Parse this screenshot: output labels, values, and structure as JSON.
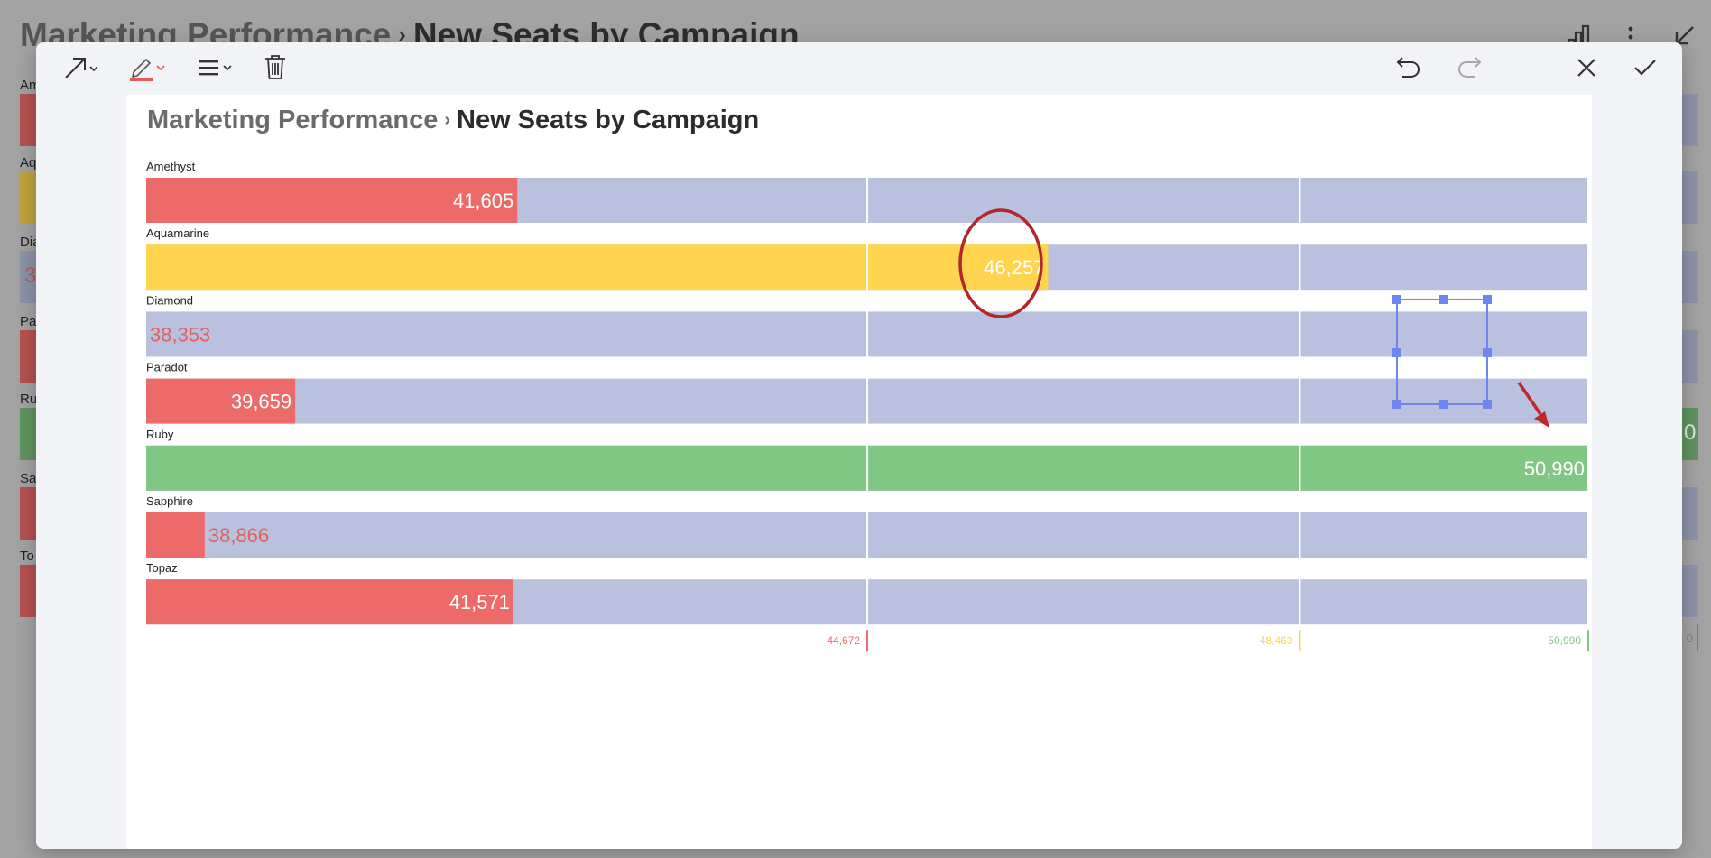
{
  "background": {
    "breadcrumb_parent": "Marketing Performance",
    "separator": "›",
    "title": "New Seats by Campaign",
    "row_labels": [
      "Am",
      "Aq",
      "Dia",
      "Pa",
      "Ru",
      "Sa",
      "To"
    ],
    "partial_value": "3",
    "right_partial_value": "0",
    "right_axis_partial": "0"
  },
  "toolbar": {
    "icons": [
      "arrow-tool-icon",
      "pen-tool-icon",
      "line-style-icon",
      "delete-icon",
      "undo-icon",
      "redo-icon",
      "close-icon",
      "confirm-icon"
    ],
    "pen_color": "#e05a5a"
  },
  "header": {
    "breadcrumb_parent": "Marketing Performance",
    "separator": "›",
    "title": "New Seats by Campaign"
  },
  "chart_data": {
    "type": "bar",
    "orientation": "horizontal",
    "title": "New Seats by Campaign",
    "categories": [
      "Amethyst",
      "Aquamarine",
      "Diamond",
      "Paradot",
      "Ruby",
      "Sapphire",
      "Topaz"
    ],
    "values": [
      41605,
      46257,
      38353,
      39659,
      50990,
      38866,
      41571
    ],
    "value_labels": [
      "41,605",
      "46,257",
      "38,353",
      "39,659",
      "50,990",
      "38,866",
      "41,571"
    ],
    "bar_colors": [
      "#ec6b68",
      "#ffd54f",
      "#ec6b68",
      "#ec6b68",
      "#81c784",
      "#ec6b68",
      "#ec6b68"
    ],
    "track_color": "#b9c1df",
    "xlim": [
      38353,
      50990
    ],
    "thresholds": [
      {
        "value": 44672,
        "label": "44,672",
        "color": "#ec6b68"
      },
      {
        "value": 48463,
        "label": "48,463",
        "color": "#ffd54f"
      },
      {
        "value": 50990,
        "label": "50,990",
        "color": "#81c784"
      }
    ],
    "grid": true,
    "legend": "none"
  },
  "annotations": {
    "ellipse_color": "#b3262b",
    "arrow_color": "#c0262b",
    "selection_color": "#6f86f2"
  }
}
